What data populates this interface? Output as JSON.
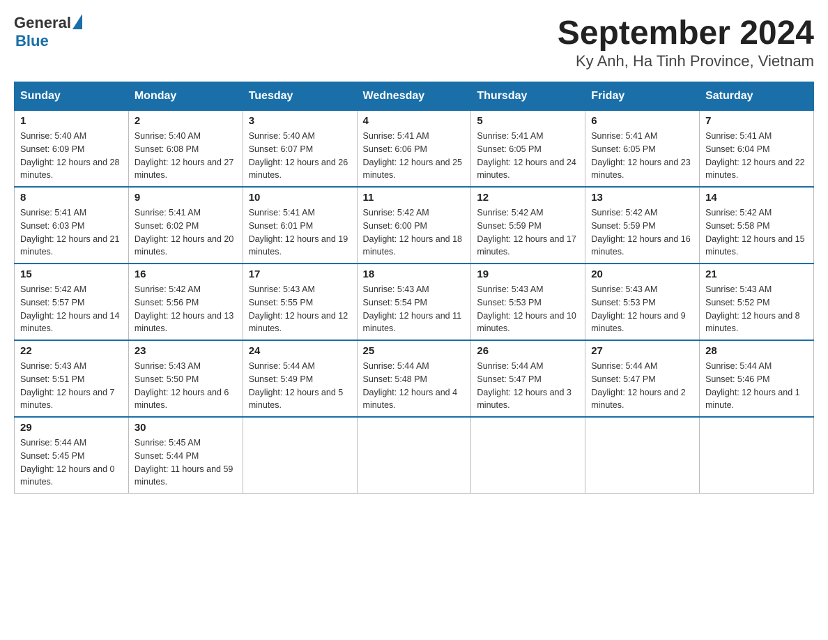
{
  "header": {
    "logo_general": "General",
    "logo_blue": "Blue",
    "title": "September 2024",
    "subtitle": "Ky Anh, Ha Tinh Province, Vietnam"
  },
  "days_of_week": [
    "Sunday",
    "Monday",
    "Tuesday",
    "Wednesday",
    "Thursday",
    "Friday",
    "Saturday"
  ],
  "weeks": [
    [
      {
        "day": "1",
        "sunrise": "Sunrise: 5:40 AM",
        "sunset": "Sunset: 6:09 PM",
        "daylight": "Daylight: 12 hours and 28 minutes."
      },
      {
        "day": "2",
        "sunrise": "Sunrise: 5:40 AM",
        "sunset": "Sunset: 6:08 PM",
        "daylight": "Daylight: 12 hours and 27 minutes."
      },
      {
        "day": "3",
        "sunrise": "Sunrise: 5:40 AM",
        "sunset": "Sunset: 6:07 PM",
        "daylight": "Daylight: 12 hours and 26 minutes."
      },
      {
        "day": "4",
        "sunrise": "Sunrise: 5:41 AM",
        "sunset": "Sunset: 6:06 PM",
        "daylight": "Daylight: 12 hours and 25 minutes."
      },
      {
        "day": "5",
        "sunrise": "Sunrise: 5:41 AM",
        "sunset": "Sunset: 6:05 PM",
        "daylight": "Daylight: 12 hours and 24 minutes."
      },
      {
        "day": "6",
        "sunrise": "Sunrise: 5:41 AM",
        "sunset": "Sunset: 6:05 PM",
        "daylight": "Daylight: 12 hours and 23 minutes."
      },
      {
        "day": "7",
        "sunrise": "Sunrise: 5:41 AM",
        "sunset": "Sunset: 6:04 PM",
        "daylight": "Daylight: 12 hours and 22 minutes."
      }
    ],
    [
      {
        "day": "8",
        "sunrise": "Sunrise: 5:41 AM",
        "sunset": "Sunset: 6:03 PM",
        "daylight": "Daylight: 12 hours and 21 minutes."
      },
      {
        "day": "9",
        "sunrise": "Sunrise: 5:41 AM",
        "sunset": "Sunset: 6:02 PM",
        "daylight": "Daylight: 12 hours and 20 minutes."
      },
      {
        "day": "10",
        "sunrise": "Sunrise: 5:41 AM",
        "sunset": "Sunset: 6:01 PM",
        "daylight": "Daylight: 12 hours and 19 minutes."
      },
      {
        "day": "11",
        "sunrise": "Sunrise: 5:42 AM",
        "sunset": "Sunset: 6:00 PM",
        "daylight": "Daylight: 12 hours and 18 minutes."
      },
      {
        "day": "12",
        "sunrise": "Sunrise: 5:42 AM",
        "sunset": "Sunset: 5:59 PM",
        "daylight": "Daylight: 12 hours and 17 minutes."
      },
      {
        "day": "13",
        "sunrise": "Sunrise: 5:42 AM",
        "sunset": "Sunset: 5:59 PM",
        "daylight": "Daylight: 12 hours and 16 minutes."
      },
      {
        "day": "14",
        "sunrise": "Sunrise: 5:42 AM",
        "sunset": "Sunset: 5:58 PM",
        "daylight": "Daylight: 12 hours and 15 minutes."
      }
    ],
    [
      {
        "day": "15",
        "sunrise": "Sunrise: 5:42 AM",
        "sunset": "Sunset: 5:57 PM",
        "daylight": "Daylight: 12 hours and 14 minutes."
      },
      {
        "day": "16",
        "sunrise": "Sunrise: 5:42 AM",
        "sunset": "Sunset: 5:56 PM",
        "daylight": "Daylight: 12 hours and 13 minutes."
      },
      {
        "day": "17",
        "sunrise": "Sunrise: 5:43 AM",
        "sunset": "Sunset: 5:55 PM",
        "daylight": "Daylight: 12 hours and 12 minutes."
      },
      {
        "day": "18",
        "sunrise": "Sunrise: 5:43 AM",
        "sunset": "Sunset: 5:54 PM",
        "daylight": "Daylight: 12 hours and 11 minutes."
      },
      {
        "day": "19",
        "sunrise": "Sunrise: 5:43 AM",
        "sunset": "Sunset: 5:53 PM",
        "daylight": "Daylight: 12 hours and 10 minutes."
      },
      {
        "day": "20",
        "sunrise": "Sunrise: 5:43 AM",
        "sunset": "Sunset: 5:53 PM",
        "daylight": "Daylight: 12 hours and 9 minutes."
      },
      {
        "day": "21",
        "sunrise": "Sunrise: 5:43 AM",
        "sunset": "Sunset: 5:52 PM",
        "daylight": "Daylight: 12 hours and 8 minutes."
      }
    ],
    [
      {
        "day": "22",
        "sunrise": "Sunrise: 5:43 AM",
        "sunset": "Sunset: 5:51 PM",
        "daylight": "Daylight: 12 hours and 7 minutes."
      },
      {
        "day": "23",
        "sunrise": "Sunrise: 5:43 AM",
        "sunset": "Sunset: 5:50 PM",
        "daylight": "Daylight: 12 hours and 6 minutes."
      },
      {
        "day": "24",
        "sunrise": "Sunrise: 5:44 AM",
        "sunset": "Sunset: 5:49 PM",
        "daylight": "Daylight: 12 hours and 5 minutes."
      },
      {
        "day": "25",
        "sunrise": "Sunrise: 5:44 AM",
        "sunset": "Sunset: 5:48 PM",
        "daylight": "Daylight: 12 hours and 4 minutes."
      },
      {
        "day": "26",
        "sunrise": "Sunrise: 5:44 AM",
        "sunset": "Sunset: 5:47 PM",
        "daylight": "Daylight: 12 hours and 3 minutes."
      },
      {
        "day": "27",
        "sunrise": "Sunrise: 5:44 AM",
        "sunset": "Sunset: 5:47 PM",
        "daylight": "Daylight: 12 hours and 2 minutes."
      },
      {
        "day": "28",
        "sunrise": "Sunrise: 5:44 AM",
        "sunset": "Sunset: 5:46 PM",
        "daylight": "Daylight: 12 hours and 1 minute."
      }
    ],
    [
      {
        "day": "29",
        "sunrise": "Sunrise: 5:44 AM",
        "sunset": "Sunset: 5:45 PM",
        "daylight": "Daylight: 12 hours and 0 minutes."
      },
      {
        "day": "30",
        "sunrise": "Sunrise: 5:45 AM",
        "sunset": "Sunset: 5:44 PM",
        "daylight": "Daylight: 11 hours and 59 minutes."
      },
      null,
      null,
      null,
      null,
      null
    ]
  ]
}
